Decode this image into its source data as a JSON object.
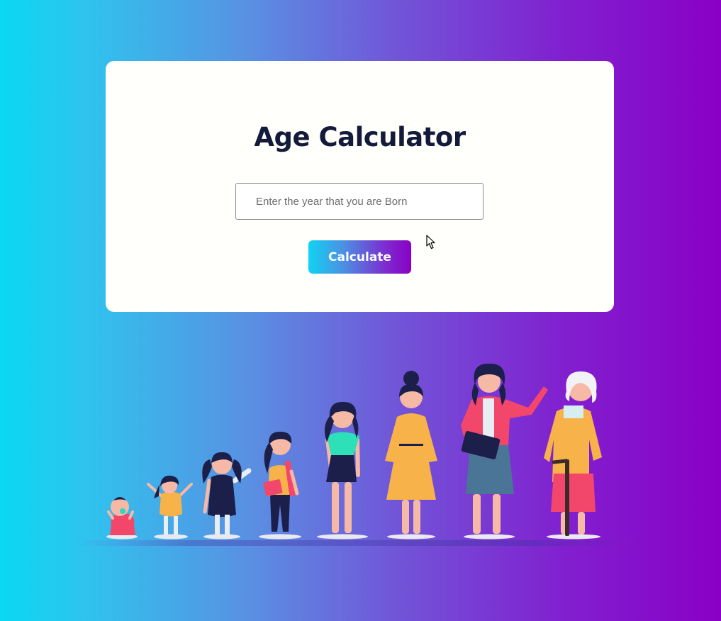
{
  "app": {
    "title": "Age Calculator"
  },
  "form": {
    "year_placeholder": "Enter the year that you are Born",
    "year_value": "",
    "calculate_label": "Calculate"
  },
  "colors": {
    "gradient_start": "#0ad8f3",
    "gradient_end": "#8a00c6",
    "title_color": "#131a3a",
    "card_background": "#fffffb"
  },
  "illustration": {
    "name": "life-stages-illustration",
    "figures": [
      "baby",
      "toddler",
      "girl",
      "schoolgirl",
      "teen",
      "young-woman",
      "adult-woman",
      "elderly-woman"
    ]
  }
}
